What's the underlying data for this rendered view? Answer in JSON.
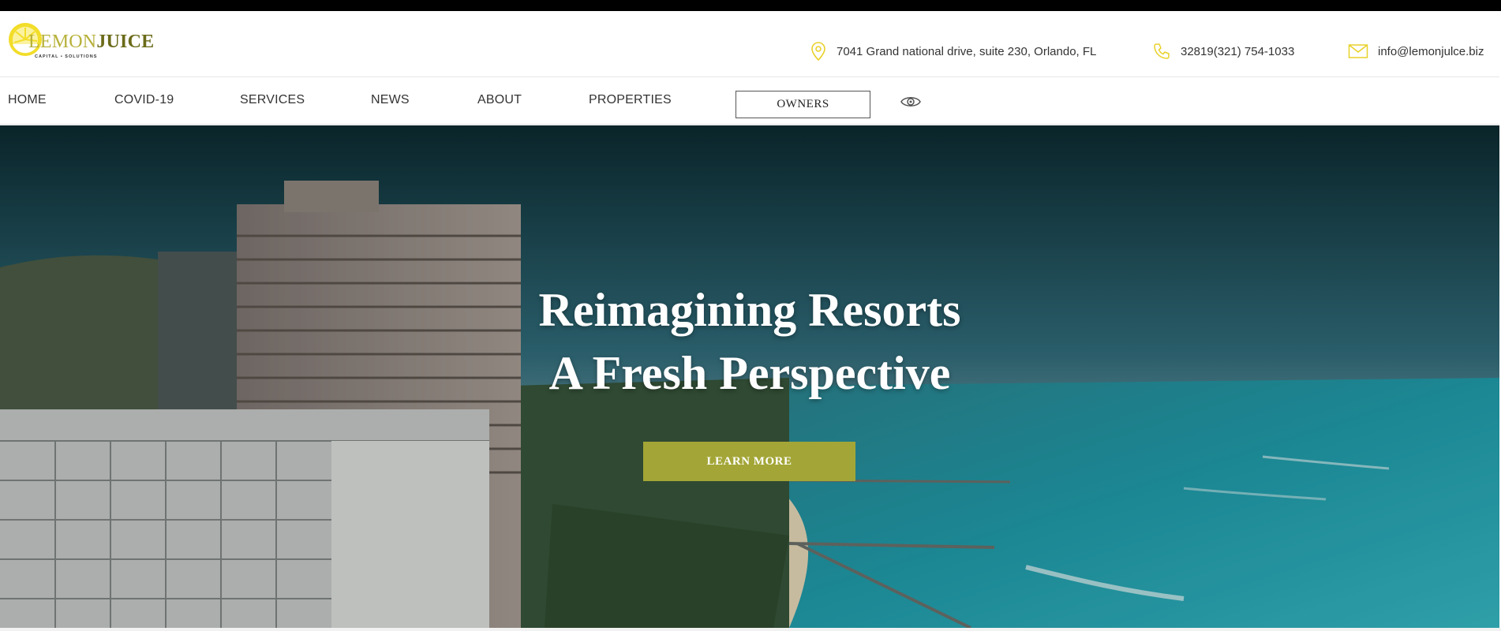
{
  "brand": {
    "logo_primary": "LEMON",
    "logo_secondary": "JUICE",
    "logo_tagline": "CAPITAL • SOLUTIONS",
    "accent_color": "#a3a636",
    "logo_color": "#f2dd2a"
  },
  "contact": {
    "address": "7041 Grand national drive, suite 230, Orlando, FL",
    "phone": "32819(321) 754-1033",
    "email": "info@lemonjulce.biz",
    "address_icon": "map-pin-icon",
    "phone_icon": "phone-icon",
    "email_icon": "envelope-icon"
  },
  "nav": {
    "items": [
      {
        "label": "HOME"
      },
      {
        "label": "COVID-19"
      },
      {
        "label": "SERVICES"
      },
      {
        "label": "NEWS"
      },
      {
        "label": "ABOUT"
      },
      {
        "label": "PROPERTIES"
      }
    ],
    "owners_label": "OWNERS",
    "accessibility_icon": "eye-icon"
  },
  "hero": {
    "title_line1": "Reimagining Resorts",
    "title_line2": "A Fresh Perspective",
    "cta_label": "LEARN MORE"
  }
}
